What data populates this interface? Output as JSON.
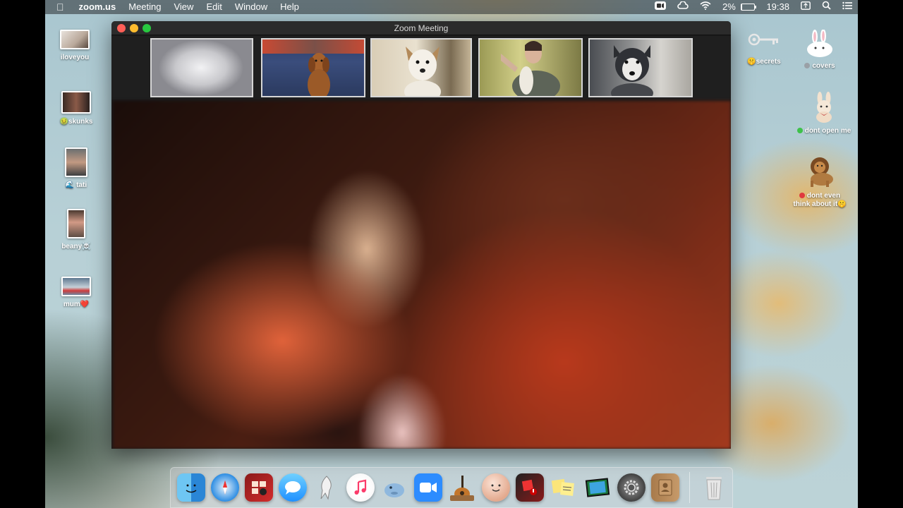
{
  "menubar": {
    "apple_icon": "apple-icon",
    "app_name": "zoom.us",
    "menus": [
      "Meeting",
      "View",
      "Edit",
      "Window",
      "Help"
    ],
    "battery_percent": "2%",
    "battery_level": 0.02,
    "time": "19:38",
    "status_icons": [
      "zoom-status-icon",
      "creative-cloud-icon",
      "wifi-icon",
      "battery-icon",
      "screen-mirror-icon",
      "spotlight-search-icon",
      "notification-center-icon"
    ]
  },
  "desktop_left": [
    {
      "label": "iloveyou",
      "tag_color": ""
    },
    {
      "label": "skunks",
      "tag_color": "#5fbd3a"
    },
    {
      "label": "tati",
      "tag_color": ""
    },
    {
      "label": "beany",
      "tag_color": ""
    },
    {
      "label": "mum",
      "tag_color": ""
    }
  ],
  "desktop_left_suffixes": {
    "tati": "🌊",
    "beany": "☠️",
    "mum": "❤️",
    "skunks": "🤢"
  },
  "desktop_right": [
    {
      "label": "secrets",
      "prefix": "🤫"
    },
    {
      "label": "covers",
      "tag_color": "#9aa0a6"
    },
    {
      "label": "dont open me",
      "tag_color": "#3ec14a"
    },
    {
      "label": "dont even think about it",
      "line1": "dont even",
      "line2": "think about it",
      "suffix": "🤫",
      "tag_color": "#e0393e"
    }
  ],
  "zoom_window": {
    "title": "Zoom Meeting",
    "participants": [
      "participant-1",
      "participant-2",
      "participant-3",
      "participant-4",
      "participant-5"
    ]
  },
  "dock": {
    "apps": [
      "Finder",
      "Safari",
      "Photo Booth",
      "Messages",
      "Inkscape",
      "Music",
      "Sequel Pro",
      "Zoom",
      "GarageBand",
      "Memoji",
      "Photo Slideshow",
      "Stickies",
      "Preview",
      "System Preferences",
      "Contacts"
    ],
    "trash": "Trash"
  }
}
